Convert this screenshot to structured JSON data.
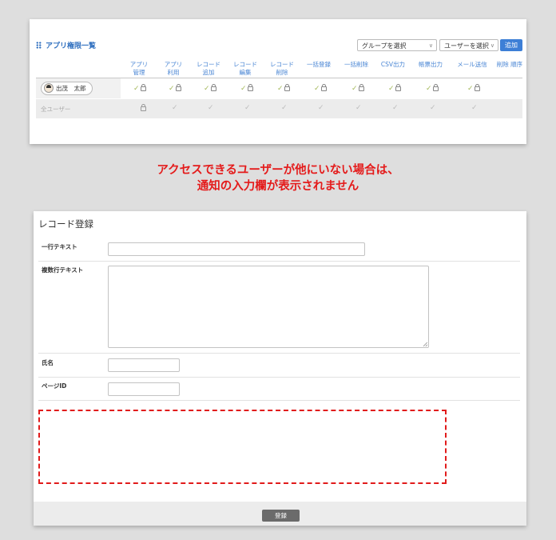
{
  "panel1": {
    "title": "アプリ権限一覧",
    "group_select": "グループを選択",
    "user_select": "ユーザーを選択",
    "add_button": "追加",
    "columns": [
      [
        "アプリ",
        "管理"
      ],
      [
        "アプリ",
        "利用"
      ],
      [
        "レコード",
        "追加"
      ],
      [
        "レコード",
        "編集"
      ],
      [
        "レコード",
        "削除"
      ],
      [
        "一括登録",
        ""
      ],
      [
        "一括削除",
        ""
      ],
      [
        "CSV出力",
        ""
      ],
      [
        "帳票出力",
        ""
      ],
      [
        "メール送信",
        ""
      ]
    ],
    "extra_column": "削除 順序",
    "user_name": "出茂　太郎",
    "all_users_label": "全ユーザー",
    "check_glyph": "✓"
  },
  "annotation": {
    "line1": "アクセスできるユーザーが他にいない場合は、",
    "line2": "通知の入力欄が表示されません"
  },
  "form": {
    "title": "レコード登録",
    "fields": {
      "single_line": {
        "label": "一行テキスト",
        "value": ""
      },
      "multi_line": {
        "label": "複数行テキスト",
        "value": ""
      },
      "name": {
        "label": "氏名",
        "value": ""
      },
      "page_id": {
        "label": "ページID",
        "value": ""
      }
    },
    "submit_button": "登録"
  },
  "colors": {
    "accent": "#3d7fd6",
    "annotation_red": "#e41b1b",
    "check_green": "#a3b85a"
  }
}
